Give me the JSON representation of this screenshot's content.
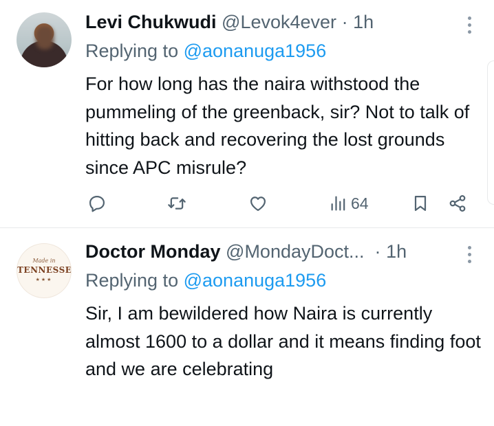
{
  "tweets": [
    {
      "display_name": "Levi Chukwudi",
      "handle": "@Levok4ever",
      "separator": "·",
      "time": "1h",
      "replying_prefix": "Replying to",
      "replying_to": "@aonanuga1956",
      "body": "For how long has the naira withstood the pummeling of the greenback, sir? Not to talk of hitting back and recovering the lost grounds since APC misrule?",
      "views": "64",
      "avatar_icon": "user-photo"
    },
    {
      "display_name": "Doctor Monday",
      "handle": "@MondayDoct...",
      "separator": "·",
      "time": "1h",
      "replying_prefix": "Replying to",
      "replying_to": "@aonanuga1956",
      "body": "Sir, I am bewildered how Naira is currently almost 1600 to a dollar and it means finding foot and we are celebrating",
      "avatar_icon": "tennessee-logo",
      "avatar_logo_text": {
        "top": "Made in",
        "word": "TENNESSEE",
        "stars": "★★★"
      }
    }
  ],
  "colors": {
    "text": "#0f1419",
    "muted": "#536471",
    "link": "#1d9bf0",
    "divider": "#e7e9ea"
  }
}
